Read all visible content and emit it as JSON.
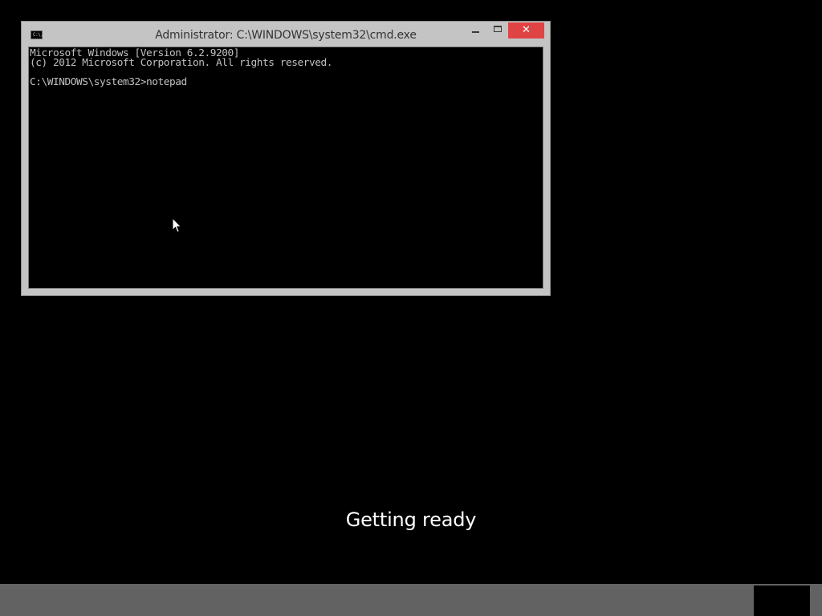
{
  "window": {
    "title": "Administrator: C:\\WINDOWS\\system32\\cmd.exe",
    "icon": "console-icon",
    "icon_glyph": "C:\\.",
    "buttons": {
      "minimize": "minimize-icon",
      "maximize": "maximize-icon",
      "close": "close-icon",
      "close_glyph": "✕"
    }
  },
  "console": {
    "lines": [
      "Microsoft Windows [Version 6.2.9200]",
      "(c) 2012 Microsoft Corporation. All rights reserved.",
      "C:\\WINDOWS\\system32>notepad"
    ],
    "text_color": "#c0c0c0",
    "background_color": "#000000"
  },
  "status": {
    "text": "Getting ready"
  },
  "colors": {
    "close_button": "#e04343",
    "window_frame": "#c4c4c4",
    "bottom_bar": "#626262"
  }
}
